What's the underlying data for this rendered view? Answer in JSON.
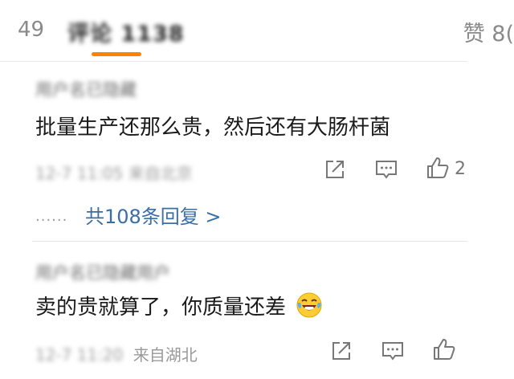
{
  "tabs": {
    "left_count": "49",
    "active_label": "评论 1138",
    "right_label": "赞",
    "right_count": "8("
  },
  "comments": [
    {
      "author": "用户名已隐藏",
      "text": "批量生产还那么贵，然后还有大肠杆菌",
      "meta": "12-7 11:05 来自北京",
      "like_count": "2",
      "replies_label": "共108条回复 >",
      "replies_dots": "......"
    },
    {
      "author": "用户名已隐藏用户",
      "text": "卖的贵就算了，你质量还差",
      "emoji": "laughing-tears",
      "meta_time": "12-7 11:20",
      "meta_location": "来自湖北"
    }
  ],
  "icons": {
    "share": "share-icon",
    "comment": "comment-icon",
    "like": "thumbs-up-icon"
  },
  "colors": {
    "accent": "#ff8200",
    "link": "#3a6ea5",
    "muted": "#9a9a9a"
  }
}
